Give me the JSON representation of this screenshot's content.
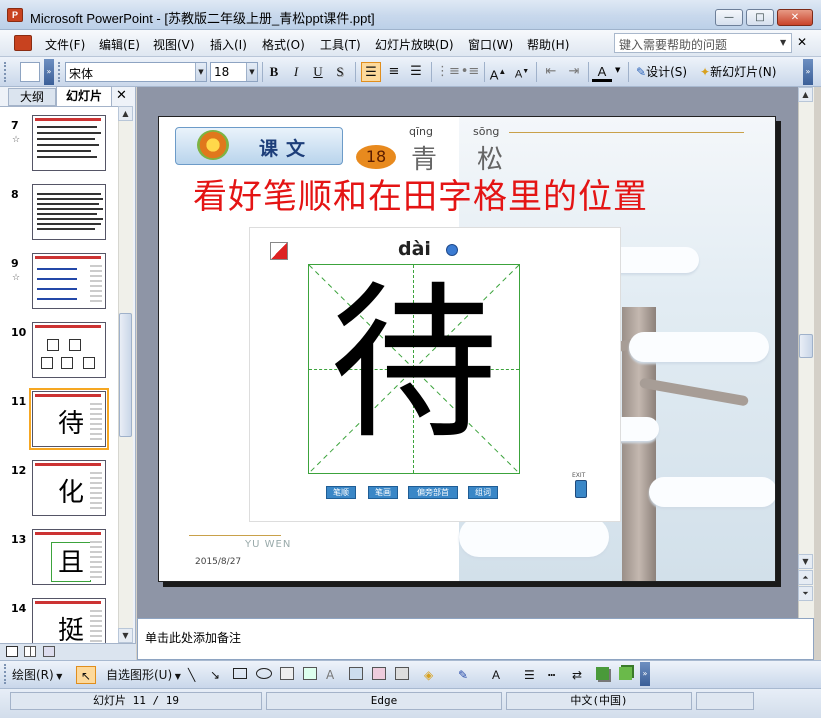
{
  "window": {
    "title": "Microsoft PowerPoint - [苏教版二年级上册_青松ppt课件.ppt]",
    "app_icon_text": "P",
    "minimize_glyph": "—",
    "maximize_glyph": "□",
    "close_glyph": "✕"
  },
  "menu": {
    "items": [
      "文件(F)",
      "编辑(E)",
      "视图(V)",
      "插入(I)",
      "格式(O)",
      "工具(T)",
      "幻灯片放映(D)",
      "窗口(W)",
      "帮助(H)"
    ],
    "help_placeholder": "键入需要帮助的问题",
    "close_glyph": "✕"
  },
  "format_toolbar": {
    "font_name": "宋体",
    "font_size": "18",
    "bold": "B",
    "italic": "I",
    "underline": "U",
    "shadow": "S",
    "design_label": "设计(S)",
    "new_slide_label": "新幻灯片(N)"
  },
  "left_pane": {
    "tabs": [
      "大纲",
      "幻灯片"
    ],
    "close_glyph": "✕",
    "thumbnails": [
      {
        "number": "7",
        "star": "☆",
        "glyph": ""
      },
      {
        "number": "8",
        "star": "",
        "glyph": ""
      },
      {
        "number": "9",
        "star": "☆",
        "glyph": ""
      },
      {
        "number": "10",
        "star": "",
        "glyph": ""
      },
      {
        "number": "11",
        "star": "",
        "glyph": "待"
      },
      {
        "number": "12",
        "star": "",
        "glyph": "化"
      },
      {
        "number": "13",
        "star": "",
        "glyph": "且"
      },
      {
        "number": "14",
        "star": "",
        "glyph": "挺"
      }
    ],
    "selected_slide": "11"
  },
  "slide": {
    "lesson_label": "课文",
    "lesson_number": "18",
    "pinyin_1": "qīng",
    "pinyin_2": "sōng",
    "lesson_char_1": "青",
    "lesson_char_2": "松",
    "title": "看好笔顺和在田字格里的位置",
    "pinyin_dai": "dài",
    "character": "待",
    "buttons": [
      "笔顺",
      "笔画",
      "偏旁部首",
      "组词"
    ],
    "exit_label": "EXIT",
    "date": "2015/8/27",
    "footer_text": "YU WEN"
  },
  "notes": {
    "placeholder": "单击此处添加备注"
  },
  "draw_toolbar": {
    "draw_label": "绘图(R)",
    "autoshapes_label": "自选图形(U)"
  },
  "status": {
    "slide_position": "幻灯片 11 / 19",
    "design": "Edge",
    "language": "中文(中国)"
  },
  "colors": {
    "title_red": "#e41414",
    "grid_green": "#3ca33c",
    "badge_orange": "#e88a1e",
    "selection_orange": "#f6a722"
  }
}
